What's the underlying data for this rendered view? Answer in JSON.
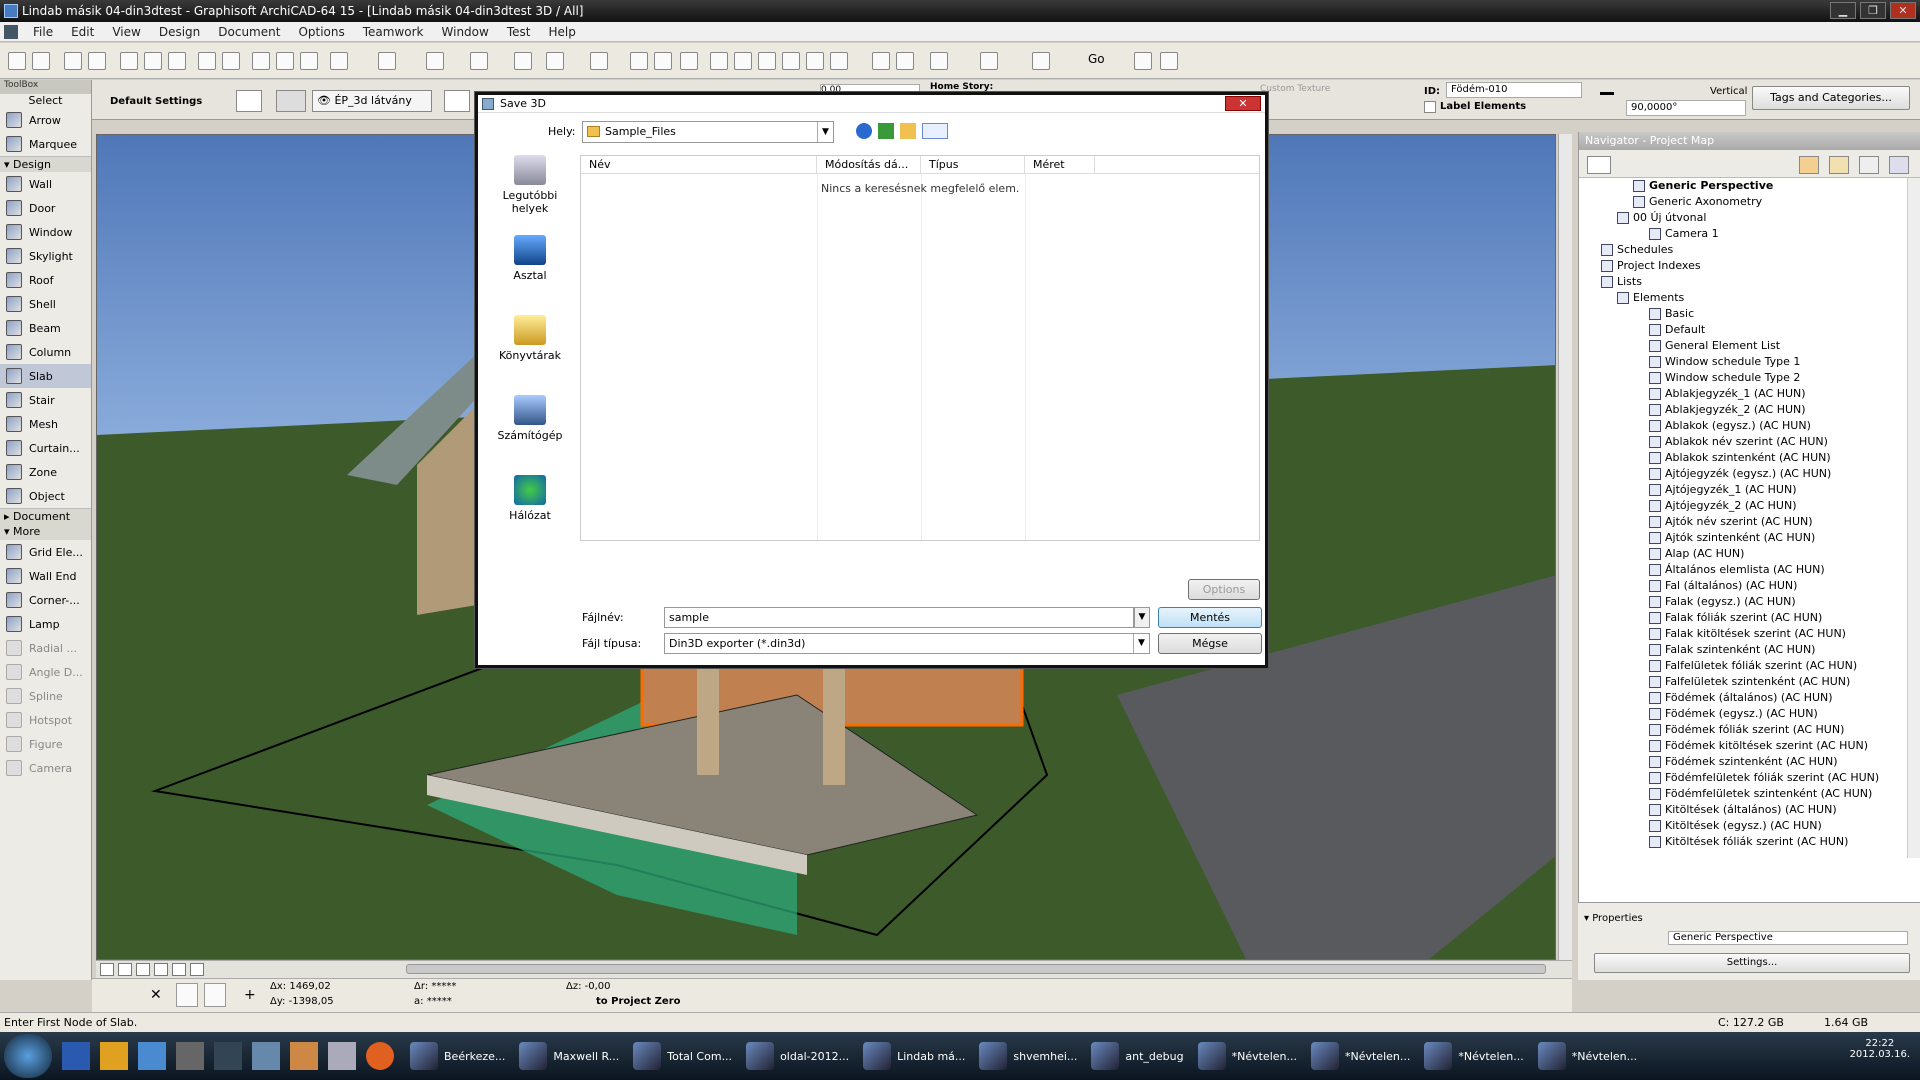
{
  "window": {
    "title": "Lindab másik 04-din3dtest - Graphisoft ArchiCAD-64 15 - [Lindab másik 04-din3dtest 3D / All]"
  },
  "menu": [
    "File",
    "Edit",
    "View",
    "Design",
    "Document",
    "Options",
    "Teamwork",
    "Window",
    "Test",
    "Help"
  ],
  "infobar": {
    "default_settings": "Default Settings",
    "view_name": "ÉP_3d látvány",
    "home_story": "Home Story:",
    "custom_texture": "Custom Texture",
    "id_label": "ID:",
    "id_value": "Födém-010",
    "label_elements": "Label Elements",
    "vertical": "Vertical",
    "angle": "90,0000°",
    "tags_button": "Tags and Categories...",
    "height_value": "0,00"
  },
  "toolbox": {
    "title": "ToolBox",
    "select": "Select",
    "arrow": "Arrow",
    "marquee": "Marquee",
    "design_section": "Design",
    "design_tools": [
      "Wall",
      "Door",
      "Window",
      "Skylight",
      "Roof",
      "Shell",
      "Beam",
      "Column",
      "Slab",
      "Stair",
      "Mesh",
      "Curtain...",
      "Zone",
      "Object"
    ],
    "document_section": "Document",
    "more_section": "More",
    "more_tools": [
      "Grid Ele...",
      "Wall End",
      "Corner-...",
      "Lamp",
      "Radial ...",
      "Angle D...",
      "Spline",
      "Hotspot",
      "Figure",
      "Camera"
    ]
  },
  "dialog": {
    "title": "Save 3D",
    "close": "✕",
    "location_label": "Hely:",
    "location_value": "Sample_Files",
    "places": [
      "Legutóbbi helyek",
      "Asztal",
      "Könyvtárak",
      "Számítógép",
      "Hálózat"
    ],
    "columns": [
      "Név",
      "Módosítás dá...",
      "Típus",
      "Méret"
    ],
    "empty_message": "Nincs a keresésnek megfelelő elem.",
    "options_button": "Options",
    "filename_label": "Fájlnév:",
    "filename_value": "sample",
    "filetype_label": "Fájl típusa:",
    "filetype_value": "Din3D exporter (*.din3d)",
    "save_button": "Mentés",
    "cancel_button": "Mégse"
  },
  "navigator": {
    "title": "Navigator - Project Map",
    "tree": [
      {
        "label": "Generic Perspective",
        "level": 3,
        "bold": true
      },
      {
        "label": "Generic Axonometry",
        "level": 3
      },
      {
        "label": "00 Új útvonal",
        "level": 2
      },
      {
        "label": "Camera 1",
        "level": 4
      },
      {
        "label": "Schedules",
        "level": 1
      },
      {
        "label": "Project Indexes",
        "level": 1
      },
      {
        "label": "Lists",
        "level": 1
      },
      {
        "label": "Elements",
        "level": 2
      },
      {
        "label": "Basic",
        "level": 4
      },
      {
        "label": "Default",
        "level": 4
      },
      {
        "label": "General Element List",
        "level": 4
      },
      {
        "label": "Window schedule Type 1",
        "level": 4
      },
      {
        "label": "Window schedule Type 2",
        "level": 4
      },
      {
        "label": "Ablakjegyzék_1 (AC HUN)",
        "level": 4
      },
      {
        "label": "Ablakjegyzék_2 (AC HUN)",
        "level": 4
      },
      {
        "label": "Ablakok (egysz.) (AC HUN)",
        "level": 4
      },
      {
        "label": "Ablakok név szerint (AC HUN)",
        "level": 4
      },
      {
        "label": "Ablakok szintenként (AC HUN)",
        "level": 4
      },
      {
        "label": "Ajtójegyzék (egysz.) (AC HUN)",
        "level": 4
      },
      {
        "label": "Ajtójegyzék_1 (AC HUN)",
        "level": 4
      },
      {
        "label": "Ajtójegyzék_2 (AC HUN)",
        "level": 4
      },
      {
        "label": "Ajtók név szerint (AC HUN)",
        "level": 4
      },
      {
        "label": "Ajtók szintenként (AC HUN)",
        "level": 4
      },
      {
        "label": "Alap (AC HUN)",
        "level": 4
      },
      {
        "label": "Általános elemlista (AC HUN)",
        "level": 4
      },
      {
        "label": "Fal (általános) (AC HUN)",
        "level": 4
      },
      {
        "label": "Falak (egysz.) (AC HUN)",
        "level": 4
      },
      {
        "label": "Falak fóliák szerint (AC HUN)",
        "level": 4
      },
      {
        "label": "Falak kitöltések szerint (AC HUN)",
        "level": 4
      },
      {
        "label": "Falak szintenként (AC HUN)",
        "level": 4
      },
      {
        "label": "Falfelületek fóliák szerint (AC HUN)",
        "level": 4
      },
      {
        "label": "Falfelületek szintenként (AC HUN)",
        "level": 4
      },
      {
        "label": "Födémek (általános) (AC HUN)",
        "level": 4
      },
      {
        "label": "Födémek (egysz.) (AC HUN)",
        "level": 4
      },
      {
        "label": "Födémek fóliák szerint (AC HUN)",
        "level": 4
      },
      {
        "label": "Födémek kitöltések szerint (AC HUN)",
        "level": 4
      },
      {
        "label": "Födémek szintenként (AC HUN)",
        "level": 4
      },
      {
        "label": "Födémfelületek fóliák szerint (AC HUN)",
        "level": 4
      },
      {
        "label": "Födémfelületek szintenként (AC HUN)",
        "level": 4
      },
      {
        "label": "Kitöltések (általános) (AC HUN)",
        "level": 4
      },
      {
        "label": "Kitöltések (egysz.) (AC HUN)",
        "level": 4
      },
      {
        "label": "Kitöltések fóliák szerint (AC HUN)",
        "level": 4
      }
    ],
    "properties_label": "Properties",
    "properties_value": "Generic Perspective",
    "settings_button": "Settings..."
  },
  "coords": {
    "dx_label": "Δx:",
    "dx": "1469,02",
    "dy_label": "Δy:",
    "dy": "-1398,05",
    "dr_label": "Δr:",
    "dr": "*****",
    "da_label": "a:",
    "da": "*****",
    "dz_label": "Δz:",
    "dz": "-0,00",
    "ref": "to Project Zero"
  },
  "status": {
    "message": "Enter First Node of Slab.",
    "disk_c": "C: 127.2 GB",
    "disk_other": "1.64 GB"
  },
  "taskbar": {
    "items": [
      "Beérkeze...",
      "Maxwell R...",
      "Total Com...",
      "oldal-2012...",
      "Lindab má...",
      "shvemhei...",
      "ant_debug",
      "*Névtelen...",
      "*Névtelen...",
      "*Névtelen...",
      "*Névtelen..."
    ],
    "time": "22:22",
    "date": "2012.03.16."
  }
}
